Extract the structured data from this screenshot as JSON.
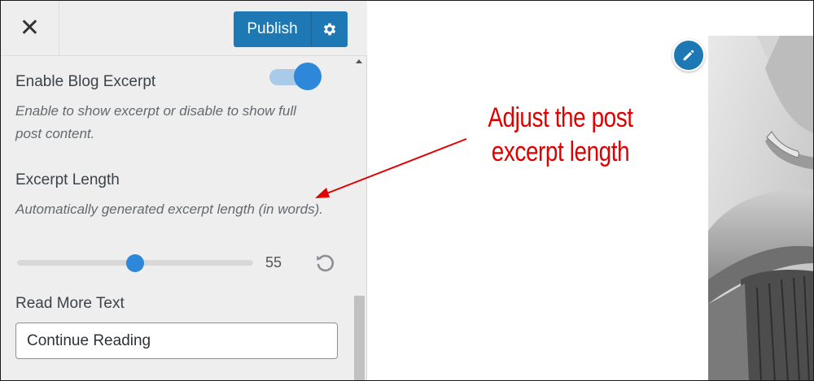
{
  "header": {
    "close_icon": "close-icon",
    "publish_label": "Publish",
    "settings_icon": "gear-icon"
  },
  "controls": {
    "blog_excerpt": {
      "title": "Enable Blog Excerpt",
      "description": "Enable to show excerpt or disable to show full post content.",
      "enabled": true
    },
    "excerpt_length": {
      "title": "Excerpt Length",
      "description": "Automatically generated excerpt length (in words).",
      "value": "55",
      "slider_fraction": 0.5,
      "reset_icon": "reset-icon"
    },
    "read_more": {
      "title": "Read More Text",
      "value": "Continue Reading"
    }
  },
  "preview": {
    "edit_icon": "pencil-icon",
    "image": "hat-photo"
  },
  "annotation": {
    "line1": "Adjust the post",
    "line2": "excerpt length",
    "color": "#e00000"
  },
  "colors": {
    "accent": "#1e78b4",
    "toggle_on": "#2f87d9",
    "sidebar_bg": "#eeeeee"
  }
}
